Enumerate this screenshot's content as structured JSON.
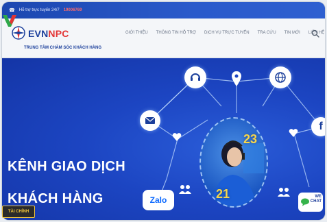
{
  "topbar": {
    "support_text": "Hỗ trợ trực tuyến 24/7",
    "hotline": "19006769"
  },
  "header": {
    "brand_prefix": "EVN",
    "brand_suffix": "NPC",
    "subtitle": "TRUNG TÂM CHĂM SÓC KHÁCH HÀNG",
    "nav": [
      "GIỚI THIỆU",
      "THÔNG TIN HỖ TRỢ",
      "DỊCH VỤ TRỰC TUYẾN",
      "TRA CỨU",
      "TIN MỚI",
      "LIÊN HỆ"
    ]
  },
  "hero": {
    "title_line1": "KÊNH GIAO DỊCH",
    "title_line2": "KHÁCH HÀNG",
    "number_a": "23",
    "number_b": "21",
    "zalo_label": "Zalo",
    "chat_label_top": "WE",
    "chat_label_bottom": "CHAT"
  },
  "overlay": {
    "channel_badge": "TÀI CHÍNH"
  },
  "colors": {
    "brand_blue": "#1b3f9b",
    "brand_red": "#e33434",
    "hero_blue": "#1c45c2",
    "accent_yellow": "#f7d64a"
  }
}
